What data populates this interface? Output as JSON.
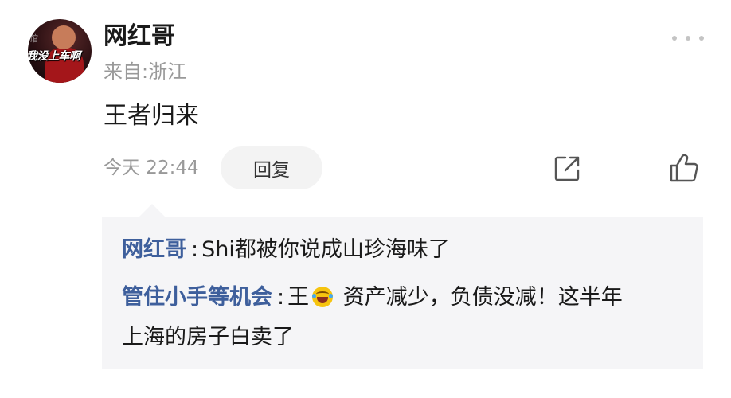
{
  "comment": {
    "username": "网红哥",
    "location": "来自:浙江",
    "text": "王者归来",
    "timestamp": "今天 22:44",
    "reply_label": "回复",
    "avatar_caption": "我没上车啊",
    "avatar_caption_top": "馆",
    "link_color": "#3e5f9c"
  },
  "icons": {
    "more": "more-dots-icon",
    "share": "share-icon",
    "like": "thumbs-up-icon",
    "emoji": "laughing-tears-emoji"
  },
  "replies": [
    {
      "name": "网红哥",
      "separator": ":",
      "text": "Shi都被你说成山珍海味了"
    },
    {
      "name": "管住小手等机会",
      "separator": ":",
      "text_before_emoji": "王",
      "text_after_emoji": " 资产减少，负债没减！这半年",
      "text_line2": "上海的房子白卖了"
    }
  ]
}
